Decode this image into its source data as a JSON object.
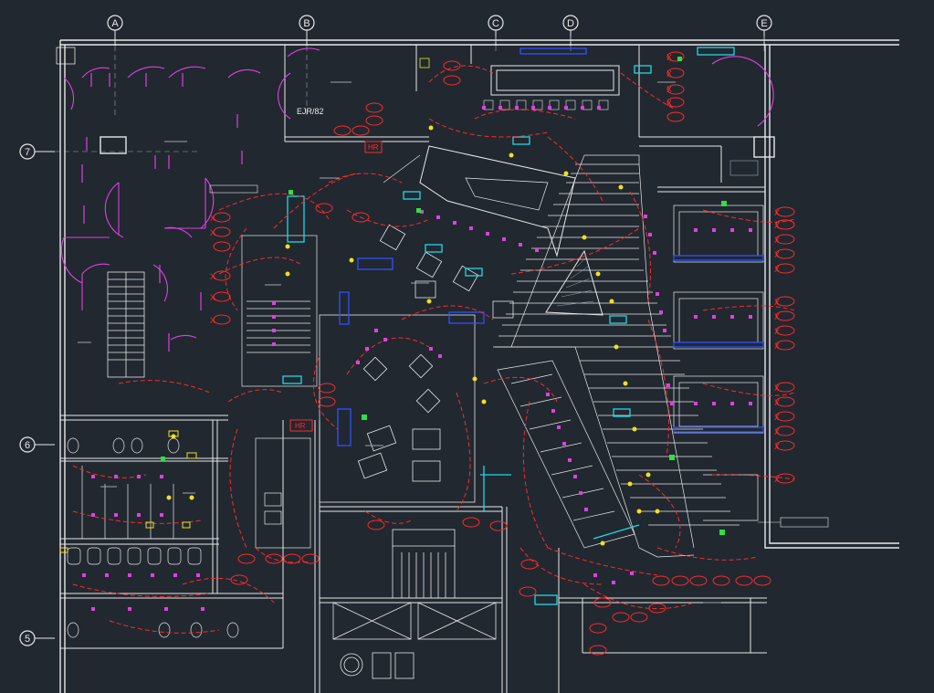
{
  "colors": {
    "background": "#212830",
    "wall": "#e8e8e8",
    "wall_dim": "#9aa3ad",
    "circuit": "#ff2a2a",
    "door": "#e040e0",
    "cyan": "#20d8e8",
    "blue": "#3050ff",
    "yellow": "#f0e020",
    "green": "#30e040"
  },
  "grid": {
    "columns": [
      "A",
      "B",
      "C",
      "D",
      "E"
    ],
    "rows": [
      "7",
      "6",
      "5"
    ]
  },
  "room_labels": {
    "ejr": "EJR/82",
    "hr_top": "HR",
    "hr_mid": "HR"
  },
  "circuit_tags": [
    "X",
    "X",
    "X",
    "X",
    "X",
    "X",
    "X",
    "X",
    "X",
    "X",
    "X",
    "X",
    "X",
    "X",
    "X",
    "X",
    "X",
    "X",
    "X",
    "X",
    "X",
    "X",
    "X",
    "X"
  ]
}
